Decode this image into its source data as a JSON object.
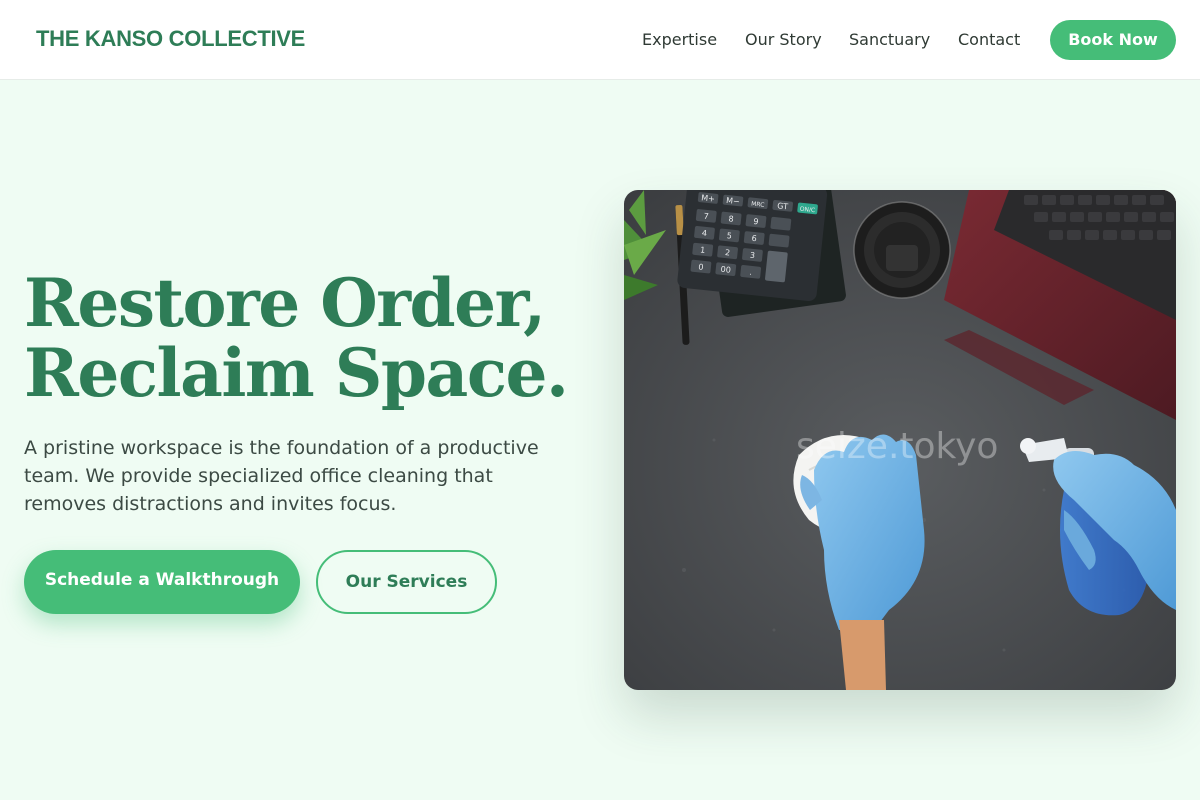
{
  "header": {
    "brand": "THE KANSO COLLECTIVE",
    "nav": [
      {
        "label": "Expertise"
      },
      {
        "label": "Our Story"
      },
      {
        "label": "Sanctuary"
      },
      {
        "label": "Contact"
      }
    ],
    "cta_label": "Book Now"
  },
  "hero": {
    "title_line1": "Restore Order,",
    "title_line2": "Reclaim Space.",
    "description": "A pristine workspace is the foundation of a productive team. We provide specialized office cleaning that removes distractions and invites focus.",
    "primary_cta": "Schedule a Walkthrough",
    "secondary_cta": "Our Services",
    "image_watermark": "seize.tokyo",
    "calculator_keys": [
      "M+",
      "M−",
      "MRC",
      "GT",
      "ON/C",
      "7",
      "8",
      "9",
      "4",
      "5",
      "6",
      "1",
      "2",
      "3",
      "0",
      "00",
      "."
    ]
  },
  "colors": {
    "accent": "#45bd78",
    "brand": "#2e7d57",
    "background": "#effcf3"
  }
}
